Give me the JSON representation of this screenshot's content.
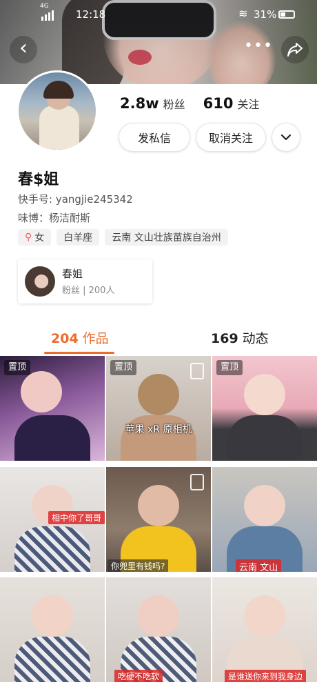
{
  "status_bar": {
    "network": "4G",
    "time": "12:18",
    "battery": "31%"
  },
  "profile": {
    "fans_count": "2.8w",
    "fans_label": "粉丝",
    "following_count": "610",
    "following_label": "关注",
    "message_button": "发私信",
    "unfollow_button": "取消关注",
    "name": "春$姐",
    "kwai_id": "快手号: yangjie245342",
    "weibo": "味博：杨洁耐斯",
    "tags": {
      "gender": "女",
      "zodiac": "白羊座",
      "location": "云南 文山壮族苗族自治州"
    },
    "fan_group": {
      "name": "春姐",
      "count": "粉丝 | 200人"
    }
  },
  "tabs": {
    "works_count": "204",
    "works_label": "作品",
    "moments_count": "169",
    "moments_label": "动态"
  },
  "grid": {
    "pinned_label": "置顶",
    "captions": {
      "c2": "苹果 xR 原相机",
      "c4": "相中你了哥哥",
      "c5": "你兜里有钱吗?",
      "c6": "云南 文山",
      "c8": "吃硬不吃软",
      "c9": "是谁送你来到我身边"
    }
  },
  "colors": {
    "accent": "#ee6b2b",
    "female": "#e8615a"
  }
}
